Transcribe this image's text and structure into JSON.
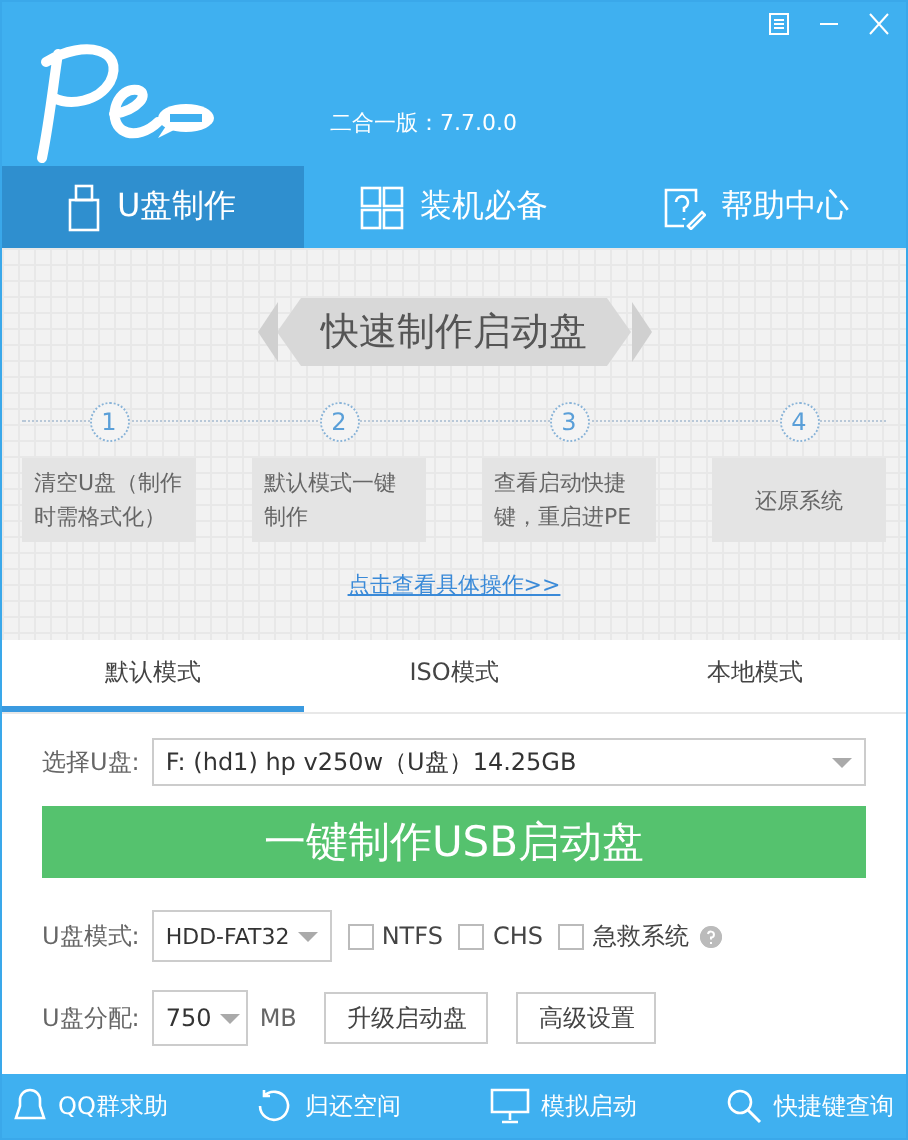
{
  "header": {
    "version": "二合一版：7.7.0.0"
  },
  "nav_tabs": [
    {
      "label": "U盘制作",
      "kind": "usb",
      "selected": true
    },
    {
      "label": "装机必备",
      "kind": "grid",
      "selected": false
    },
    {
      "label": "帮助中心",
      "kind": "help",
      "selected": false
    }
  ],
  "guide": {
    "title": "快速制作启动盘",
    "steps": [
      {
        "number": "1",
        "text": "清空U盘（制作时需格式化）"
      },
      {
        "number": "2",
        "text": "默认模式一键制作"
      },
      {
        "number": "3",
        "text": "查看启动快捷键，重启进PE"
      },
      {
        "number": "4",
        "text": "还原系统"
      }
    ],
    "link": "点击查看具体操作>>"
  },
  "mode_tabs": [
    {
      "label": "默认模式",
      "selected": true
    },
    {
      "label": "ISO模式",
      "selected": false
    },
    {
      "label": "本地模式",
      "selected": false
    }
  ],
  "drive": {
    "label": "选择U盘:",
    "value": "F: (hd1) hp v250w（U盘）14.25GB"
  },
  "make_button": "一键制作USB启动盘",
  "mode": {
    "label": "U盘模式:",
    "value": "HDD-FAT32",
    "options": [
      {
        "label": "NTFS",
        "checked": false
      },
      {
        "label": "CHS",
        "checked": false
      },
      {
        "label": "急救系统",
        "checked": false
      }
    ]
  },
  "alloc": {
    "label": "U盘分配:",
    "value": "750",
    "unit": "MB",
    "buttons": [
      "升级启动盘",
      "高级设置"
    ]
  },
  "footer": [
    {
      "label": "QQ群求助",
      "kind": "qq"
    },
    {
      "label": "归还空间",
      "kind": "restore"
    },
    {
      "label": "模拟启动",
      "kind": "monitor"
    },
    {
      "label": "快捷键查询",
      "kind": "search"
    }
  ]
}
